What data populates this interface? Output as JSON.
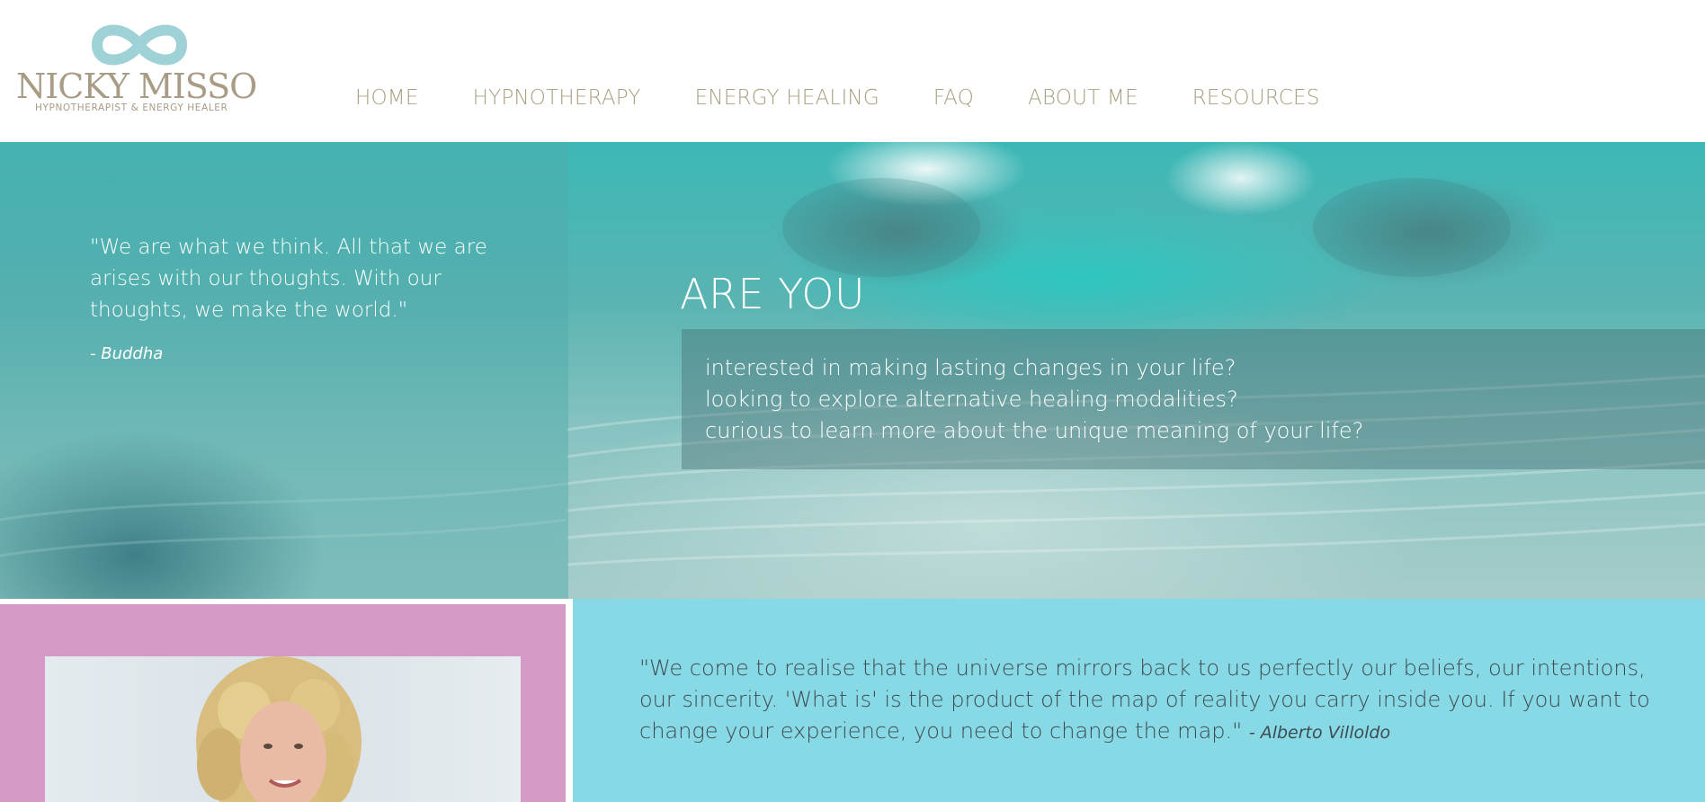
{
  "header": {
    "logo": {
      "name": "NICKY MISSO",
      "tagline": "HYPNOTHERAPIST & ENERGY HEALER",
      "icon": "infinity-icon",
      "color": "#a89c86",
      "icon_color": "#9fd2d6"
    },
    "nav": [
      {
        "label": "HOME"
      },
      {
        "label": "HYPNOTHERAPY"
      },
      {
        "label": "ENERGY HEALING"
      },
      {
        "label": "FAQ"
      },
      {
        "label": "ABOUT ME"
      },
      {
        "label": "RESOURCES"
      }
    ],
    "nav_color": "#a9a081"
  },
  "hero": {
    "quote": {
      "text": "\"We are what we think. All that we are arises with our thoughts. With our thoughts, we make the world.\"",
      "author": "- Buddha"
    },
    "are_you": {
      "title": "ARE YOU",
      "lines": [
        "interested in making lasting changes in your life?",
        "looking to explore alternative healing modalities?",
        "curious to learn more about the unique meaning of your life?"
      ]
    }
  },
  "bottom": {
    "quote": {
      "text": "\"We come to realise that the universe mirrors back to us perfectly our beliefs, our intentions, our sincerity. 'What is' is the product of the map of reality you carry inside you. If you want to change your experience, you need to change the map.\"",
      "author": "- Alberto Villoldo"
    },
    "colors": {
      "pink_panel": "#d69ac6",
      "blue_panel": "#88d9e6"
    }
  }
}
